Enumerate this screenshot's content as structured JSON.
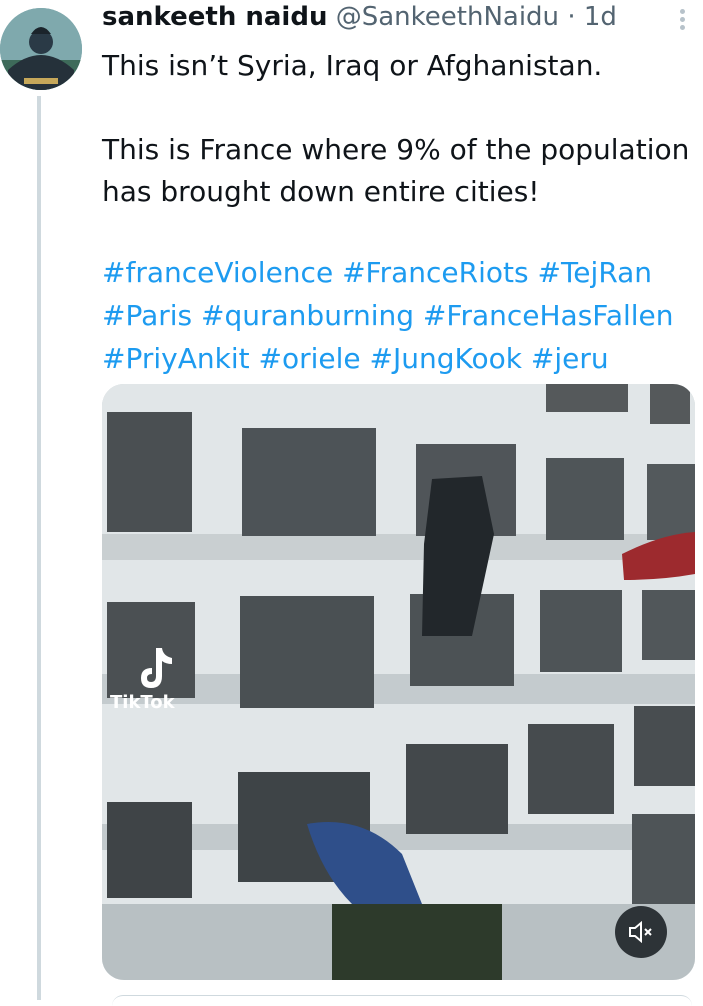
{
  "tweet": {
    "author_name": "sankeeth naidu",
    "author_handle": "@SankeethNaidu",
    "separator": "·",
    "time": "1d",
    "text_line1": "This isn’t Syria, Iraq or Afghanistan.",
    "text_line2": "This is France where 9% of the population",
    "text_line3": "has brought down entire cities!",
    "hashtags": [
      "#franceViolence",
      "#FranceRiots",
      "#TejRan",
      "#Paris",
      "#quranburning",
      "#FranceHasFallen",
      "#PriyAnkit",
      "#oriele",
      "#JungKook",
      "#jeru"
    ]
  },
  "media": {
    "watermark": "TikTok",
    "icons": {
      "mute": "speaker-mute-icon",
      "more": "more-vertical-icon",
      "tiktok": "tiktok-logo-icon"
    }
  },
  "colors": {
    "link": "#1d9bf0",
    "muted": "#536471",
    "text": "#0f1419",
    "line": "#cfd9de"
  }
}
